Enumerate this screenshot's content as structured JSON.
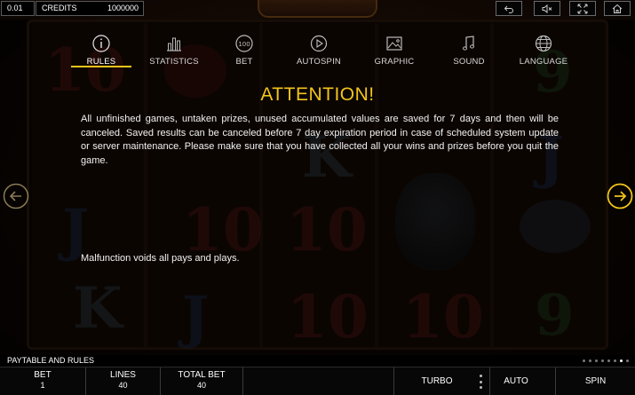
{
  "topbar": {
    "stake": "0.01",
    "credits_label": "CREDITS",
    "credits_value": "1000000",
    "controls": [
      {
        "name": "back-icon"
      },
      {
        "name": "mute-icon"
      },
      {
        "name": "fullscreen-icon"
      },
      {
        "name": "home-icon"
      }
    ]
  },
  "menu": {
    "tabs": [
      {
        "label": "RULES",
        "icon": "info-icon",
        "active": true
      },
      {
        "label": "STATISTICS",
        "icon": "bar-chart-icon"
      },
      {
        "label": "BET",
        "icon": "coin-100-icon"
      },
      {
        "label": "AUTOSPIN",
        "icon": "autoplay-icon"
      },
      {
        "label": "GRAPHIC",
        "icon": "image-icon"
      },
      {
        "label": "SOUND",
        "icon": "music-note-icon"
      },
      {
        "label": "LANGUAGE",
        "icon": "globe-icon"
      }
    ]
  },
  "content": {
    "heading": "ATTENTION!",
    "paragraph": "All unfinished games, untaken prizes, unused accumulated values are saved for 7 days and then will be canceled. Saved results can be canceled before 7 day expiration period in case of scheduled system update or server maintenance. Please make sure that you have collected all your wins and prizes before you quit the game.",
    "malfunction": "Malfunction voids all pays and plays."
  },
  "colors": {
    "accent": "#f2c51a",
    "background": "#0b0704"
  },
  "rules_bar": {
    "title": "PAYTABLE AND RULES",
    "pages_total": 8,
    "current_page": 7
  },
  "panel": {
    "bet_label": "BET",
    "bet_value": "1",
    "lines_label": "LINES",
    "lines_value": "40",
    "total_bet_label": "TOTAL BET",
    "total_bet_value": "40",
    "turbo_label": "TURBO",
    "auto_label": "AUTO",
    "spin_label": "SPIN"
  }
}
